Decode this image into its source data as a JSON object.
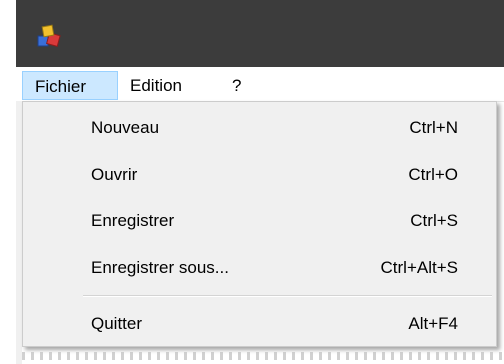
{
  "window": {
    "icon": "app-blocks-icon"
  },
  "menubar": {
    "items": [
      {
        "label": "Fichier",
        "active": true
      },
      {
        "label": "Edition",
        "active": false
      },
      {
        "label": "?",
        "active": false
      }
    ]
  },
  "dropdown": {
    "items": [
      {
        "label": "Nouveau",
        "shortcut": "Ctrl+N"
      },
      {
        "label": "Ouvrir",
        "shortcut": "Ctrl+O"
      },
      {
        "label": "Enregistrer",
        "shortcut": "Ctrl+S"
      },
      {
        "label": "Enregistrer sous...",
        "shortcut": "Ctrl+Alt+S"
      },
      {
        "label": "Quitter",
        "shortcut": "Alt+F4"
      }
    ]
  },
  "colors": {
    "titlebar": "#3c3c3c",
    "menu_highlight": "#cce8ff",
    "menu_highlight_border": "#99d1ff",
    "dropdown_bg": "#f0f0f0"
  }
}
